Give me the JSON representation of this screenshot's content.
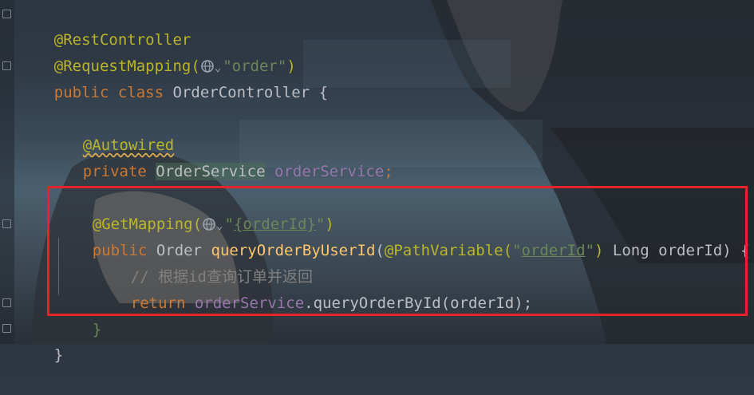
{
  "editor": {
    "lines": {
      "l1": {
        "annotation": "@RestController"
      },
      "l2": {
        "annotation": "@RequestMapping(",
        "string": "\"order\"",
        "close": ")"
      },
      "l3": {
        "kw1": "public",
        "kw2": "class",
        "name": "OrderController",
        "brace": "{"
      },
      "l5": {
        "annotation": "@Autowired"
      },
      "l6": {
        "kw": "private",
        "type": "OrderService",
        "field": "orderService",
        "semi": ";"
      },
      "l8": {
        "annotation": "@GetMapping(",
        "string_open": "\"",
        "path": "{orderId}",
        "string_close": "\"",
        "close": ")"
      },
      "l9": {
        "kw": "public",
        "type": "Order",
        "method": "queryOrderByUserId",
        "paren_open": "(",
        "param_ann": "@PathVariable(",
        "param_str_open": "\"",
        "param_str": "orderId",
        "param_str_close": "\"",
        "param_close": ")",
        "param_type": "Long",
        "param_name": "orderId",
        "sig_close": ")",
        "brace": "{"
      },
      "l10": {
        "comment": "// 根据id查询订单并返回"
      },
      "l11": {
        "kw": "return",
        "field": "orderService",
        "dot": ".",
        "call": "queryOrderById(orderId);"
      },
      "l12": {
        "brace": "}"
      },
      "l13": {
        "brace": "}"
      }
    },
    "icons": {
      "mapping": "globe-icon",
      "dropdown": "chevron-down-icon"
    },
    "colors": {
      "annotation": "#bbb529",
      "keyword": "#cc7832",
      "string": "#6a8759",
      "field": "#9876aa",
      "method": "#ffc66d",
      "comment": "#808080",
      "highlight_box": "#e5242a"
    }
  }
}
